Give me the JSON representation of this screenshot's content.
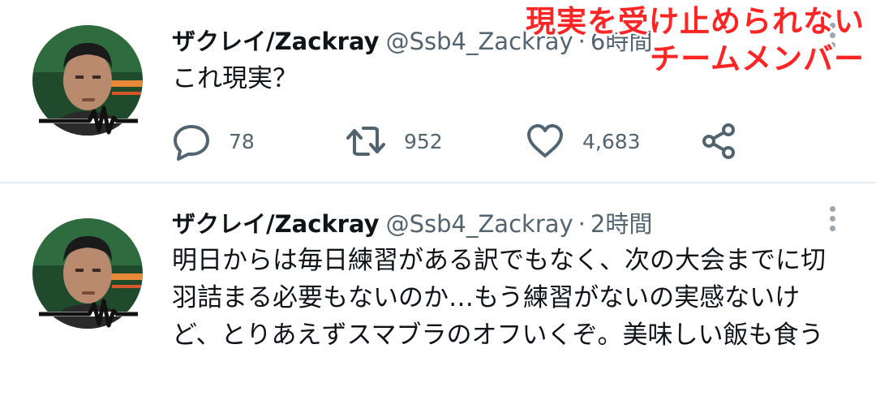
{
  "caption": {
    "line1": "現実を受け止められない",
    "line2": "チームメンバー"
  },
  "tweets": [
    {
      "display_name": "ザクレイ/Zackray",
      "handle": "@Ssb4_Zackray",
      "separator": "·",
      "time": "6時間",
      "text": "これ現実？",
      "actions": {
        "reply_count": "78",
        "retweet_count": "952",
        "like_count": "4,683"
      }
    },
    {
      "display_name": "ザクレイ/Zackray",
      "handle": "@Ssb4_Zackray",
      "separator": "·",
      "time": "2時間",
      "text": "明日からは毎日練習がある訳でもなく、次の大会までに切羽詰まる必要もないのか…もう練習がないの実感ないけど、とりあえずスマブラのオフいくぞ。美味しい飯も食う"
    }
  ],
  "colors": {
    "caption_red": "#ff2525",
    "secondary_text": "#536471",
    "avatar_background": "#1f4a2c"
  },
  "icons": [
    "avatar",
    "reply-icon",
    "retweet-icon",
    "like-icon",
    "share-icon",
    "more-icon"
  ]
}
